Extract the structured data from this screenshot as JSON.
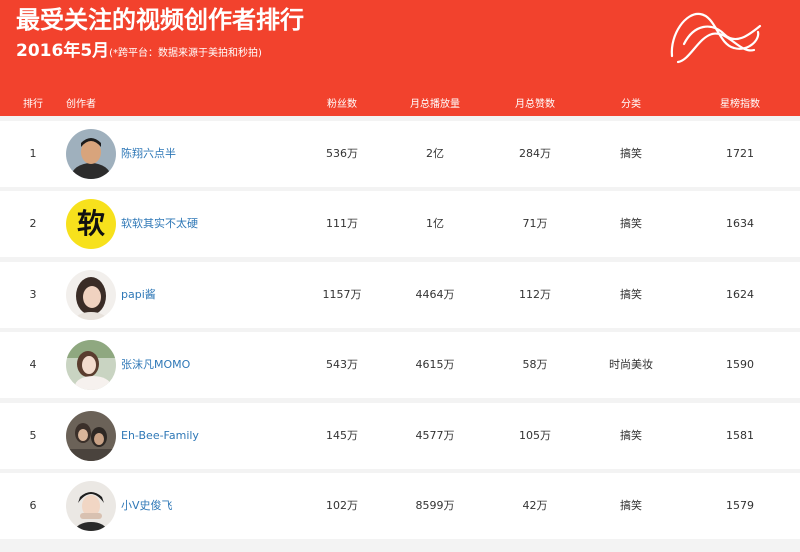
{
  "header": {
    "title": "最受关注的视频创作者排行",
    "date": "2016年5月",
    "note": "(*跨平台：数据来源于美拍和秒拍)",
    "logo": "meipai-logo-icon"
  },
  "columns": [
    "排行",
    "创作者",
    "粉丝数",
    "月总播放量",
    "月总赞数",
    "分类",
    "星榜指数"
  ],
  "rows": [
    {
      "rank": "1",
      "name": "陈翔六点半",
      "fans": "536万",
      "plays": "2亿",
      "likes": "284万",
      "category": "搞笑",
      "index": "1721",
      "avatar": "avatar-man-icon"
    },
    {
      "rank": "2",
      "name": "软软其实不太硬",
      "fans": "111万",
      "plays": "1亿",
      "likes": "71万",
      "category": "搞笑",
      "index": "1634",
      "avatar": "ruan-character-icon",
      "avatar_char": "软"
    },
    {
      "rank": "3",
      "name": "papi酱",
      "fans": "1157万",
      "plays": "4464万",
      "likes": "112万",
      "category": "搞笑",
      "index": "1624",
      "avatar": "avatar-woman-icon"
    },
    {
      "rank": "4",
      "name": "张沫凡MOMO",
      "fans": "543万",
      "plays": "4615万",
      "likes": "58万",
      "category": "时尚美妆",
      "index": "1590",
      "avatar": "avatar-woman-photo-icon"
    },
    {
      "rank": "5",
      "name": "Eh-Bee-Family",
      "fans": "145万",
      "plays": "4577万",
      "likes": "105万",
      "category": "搞笑",
      "index": "1581",
      "avatar": "avatar-family-icon"
    },
    {
      "rank": "6",
      "name": "小V史俊飞",
      "fans": "102万",
      "plays": "8599万",
      "likes": "42万",
      "category": "搞笑",
      "index": "1579",
      "avatar": "avatar-boy-icon"
    }
  ],
  "colors": {
    "header": "#f2422d",
    "link": "#2f78b7"
  }
}
